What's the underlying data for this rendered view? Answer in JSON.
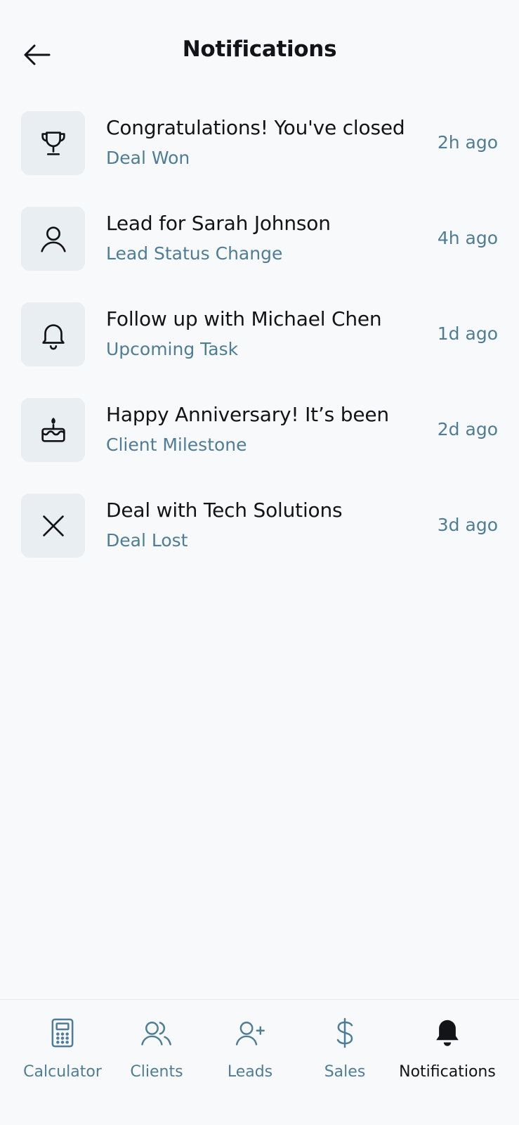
{
  "header": {
    "title": "Notifications",
    "back_icon": "arrow-left-icon"
  },
  "notifications": [
    {
      "icon": "trophy-icon",
      "message": "Congratulations! You've closed",
      "category": "Deal Won",
      "time": "2h ago"
    },
    {
      "icon": "user-icon",
      "message": "Lead for Sarah Johnson",
      "category": "Lead Status Change",
      "time": "4h ago"
    },
    {
      "icon": "bell-icon",
      "message": "Follow up with Michael Chen",
      "category": "Upcoming Task",
      "time": "1d ago"
    },
    {
      "icon": "cake-icon",
      "message": "Happy Anniversary! It’s been",
      "category": "Client Milestone",
      "time": "2d ago"
    },
    {
      "icon": "close-icon",
      "message": "Deal with Tech Solutions",
      "category": "Deal Lost",
      "time": "3d ago"
    }
  ],
  "tabs": [
    {
      "label": "Calculator",
      "icon": "calculator-icon",
      "active": false
    },
    {
      "label": "Clients",
      "icon": "users-icon",
      "active": false
    },
    {
      "label": "Leads",
      "icon": "user-plus-icon",
      "active": false
    },
    {
      "label": "Sales",
      "icon": "dollar-icon",
      "active": false
    },
    {
      "label": "Notifications",
      "icon": "bell-filled-icon",
      "active": true
    }
  ],
  "colors": {
    "background": "#f7f9fb",
    "icon_tile": "#e8eef2",
    "accent_text": "#4f7d96",
    "primary_text": "#121417"
  }
}
